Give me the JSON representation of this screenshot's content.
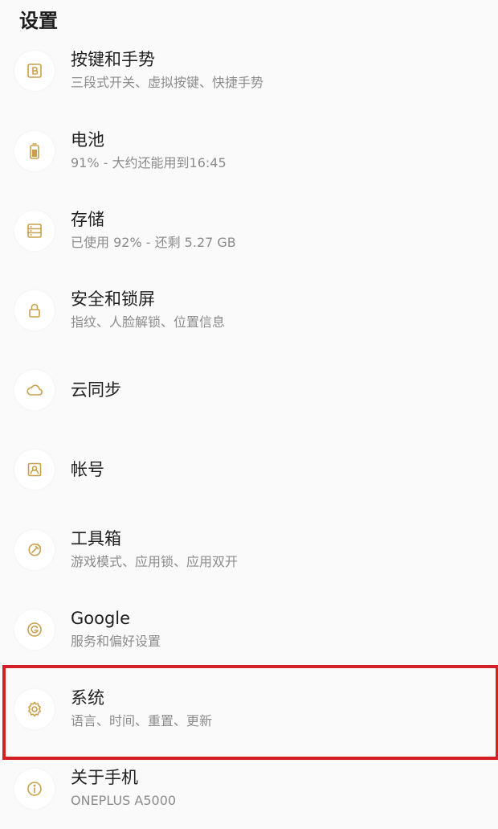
{
  "header": {
    "title": "设置"
  },
  "items": [
    {
      "label": "按键和手势",
      "summary": "三段式开关、虚拟按键、快捷手势",
      "icon": "buttons-b-icon"
    },
    {
      "label": "电池",
      "summary": "91% - 大约还能用到16:45",
      "icon": "battery-icon"
    },
    {
      "label": "存储",
      "summary": "已使用 92% - 还剩 5.27 GB",
      "icon": "storage-icon"
    },
    {
      "label": "安全和锁屏",
      "summary": "指纹、人脸解锁、位置信息",
      "icon": "lock-icon"
    },
    {
      "label": "云同步",
      "summary": "",
      "icon": "cloud-icon"
    },
    {
      "label": "帐号",
      "summary": "",
      "icon": "account-icon"
    },
    {
      "label": "工具箱",
      "summary": "游戏模式、应用锁、应用双开",
      "icon": "toolbox-icon"
    },
    {
      "label": "Google",
      "summary": "服务和偏好设置",
      "icon": "google-icon"
    },
    {
      "label": "系统",
      "summary": "语言、时间、重置、更新",
      "icon": "gear-icon"
    },
    {
      "label": "关于手机",
      "summary": "ONEPLUS A5000",
      "icon": "info-icon"
    }
  ],
  "colors": {
    "background": "#fafafa",
    "icon_accent": "#c9a04b",
    "highlight_border": "#d51f26",
    "summary_text": "#8c8c8c"
  }
}
